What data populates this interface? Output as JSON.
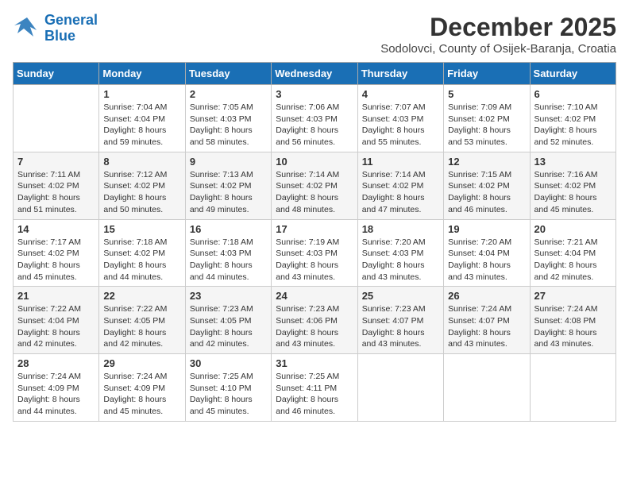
{
  "logo": {
    "line1": "General",
    "line2": "Blue"
  },
  "title": "December 2025",
  "location": "Sodolovci, County of Osijek-Baranja, Croatia",
  "weekdays": [
    "Sunday",
    "Monday",
    "Tuesday",
    "Wednesday",
    "Thursday",
    "Friday",
    "Saturday"
  ],
  "weeks": [
    [
      {
        "day": "",
        "info": ""
      },
      {
        "day": "1",
        "info": "Sunrise: 7:04 AM\nSunset: 4:04 PM\nDaylight: 8 hours\nand 59 minutes."
      },
      {
        "day": "2",
        "info": "Sunrise: 7:05 AM\nSunset: 4:03 PM\nDaylight: 8 hours\nand 58 minutes."
      },
      {
        "day": "3",
        "info": "Sunrise: 7:06 AM\nSunset: 4:03 PM\nDaylight: 8 hours\nand 56 minutes."
      },
      {
        "day": "4",
        "info": "Sunrise: 7:07 AM\nSunset: 4:03 PM\nDaylight: 8 hours\nand 55 minutes."
      },
      {
        "day": "5",
        "info": "Sunrise: 7:09 AM\nSunset: 4:02 PM\nDaylight: 8 hours\nand 53 minutes."
      },
      {
        "day": "6",
        "info": "Sunrise: 7:10 AM\nSunset: 4:02 PM\nDaylight: 8 hours\nand 52 minutes."
      }
    ],
    [
      {
        "day": "7",
        "info": "Sunrise: 7:11 AM\nSunset: 4:02 PM\nDaylight: 8 hours\nand 51 minutes."
      },
      {
        "day": "8",
        "info": "Sunrise: 7:12 AM\nSunset: 4:02 PM\nDaylight: 8 hours\nand 50 minutes."
      },
      {
        "day": "9",
        "info": "Sunrise: 7:13 AM\nSunset: 4:02 PM\nDaylight: 8 hours\nand 49 minutes."
      },
      {
        "day": "10",
        "info": "Sunrise: 7:14 AM\nSunset: 4:02 PM\nDaylight: 8 hours\nand 48 minutes."
      },
      {
        "day": "11",
        "info": "Sunrise: 7:14 AM\nSunset: 4:02 PM\nDaylight: 8 hours\nand 47 minutes."
      },
      {
        "day": "12",
        "info": "Sunrise: 7:15 AM\nSunset: 4:02 PM\nDaylight: 8 hours\nand 46 minutes."
      },
      {
        "day": "13",
        "info": "Sunrise: 7:16 AM\nSunset: 4:02 PM\nDaylight: 8 hours\nand 45 minutes."
      }
    ],
    [
      {
        "day": "14",
        "info": "Sunrise: 7:17 AM\nSunset: 4:02 PM\nDaylight: 8 hours\nand 45 minutes."
      },
      {
        "day": "15",
        "info": "Sunrise: 7:18 AM\nSunset: 4:02 PM\nDaylight: 8 hours\nand 44 minutes."
      },
      {
        "day": "16",
        "info": "Sunrise: 7:18 AM\nSunset: 4:03 PM\nDaylight: 8 hours\nand 44 minutes."
      },
      {
        "day": "17",
        "info": "Sunrise: 7:19 AM\nSunset: 4:03 PM\nDaylight: 8 hours\nand 43 minutes."
      },
      {
        "day": "18",
        "info": "Sunrise: 7:20 AM\nSunset: 4:03 PM\nDaylight: 8 hours\nand 43 minutes."
      },
      {
        "day": "19",
        "info": "Sunrise: 7:20 AM\nSunset: 4:04 PM\nDaylight: 8 hours\nand 43 minutes."
      },
      {
        "day": "20",
        "info": "Sunrise: 7:21 AM\nSunset: 4:04 PM\nDaylight: 8 hours\nand 42 minutes."
      }
    ],
    [
      {
        "day": "21",
        "info": "Sunrise: 7:22 AM\nSunset: 4:04 PM\nDaylight: 8 hours\nand 42 minutes."
      },
      {
        "day": "22",
        "info": "Sunrise: 7:22 AM\nSunset: 4:05 PM\nDaylight: 8 hours\nand 42 minutes."
      },
      {
        "day": "23",
        "info": "Sunrise: 7:23 AM\nSunset: 4:05 PM\nDaylight: 8 hours\nand 42 minutes."
      },
      {
        "day": "24",
        "info": "Sunrise: 7:23 AM\nSunset: 4:06 PM\nDaylight: 8 hours\nand 43 minutes."
      },
      {
        "day": "25",
        "info": "Sunrise: 7:23 AM\nSunset: 4:07 PM\nDaylight: 8 hours\nand 43 minutes."
      },
      {
        "day": "26",
        "info": "Sunrise: 7:24 AM\nSunset: 4:07 PM\nDaylight: 8 hours\nand 43 minutes."
      },
      {
        "day": "27",
        "info": "Sunrise: 7:24 AM\nSunset: 4:08 PM\nDaylight: 8 hours\nand 43 minutes."
      }
    ],
    [
      {
        "day": "28",
        "info": "Sunrise: 7:24 AM\nSunset: 4:09 PM\nDaylight: 8 hours\nand 44 minutes."
      },
      {
        "day": "29",
        "info": "Sunrise: 7:24 AM\nSunset: 4:09 PM\nDaylight: 8 hours\nand 45 minutes."
      },
      {
        "day": "30",
        "info": "Sunrise: 7:25 AM\nSunset: 4:10 PM\nDaylight: 8 hours\nand 45 minutes."
      },
      {
        "day": "31",
        "info": "Sunrise: 7:25 AM\nSunset: 4:11 PM\nDaylight: 8 hours\nand 46 minutes."
      },
      {
        "day": "",
        "info": ""
      },
      {
        "day": "",
        "info": ""
      },
      {
        "day": "",
        "info": ""
      }
    ]
  ]
}
